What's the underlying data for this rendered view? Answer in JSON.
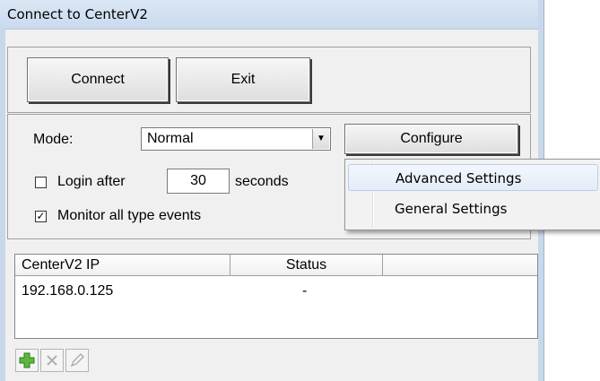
{
  "window": {
    "title": "Connect to CenterV2"
  },
  "buttons": {
    "connect": "Connect",
    "exit": "Exit",
    "configure": "Configure"
  },
  "mode": {
    "label": "Mode:",
    "value": "Normal"
  },
  "login": {
    "label": "Login after",
    "value": "30",
    "unit": "seconds",
    "checked": false
  },
  "monitor": {
    "label": "Monitor all type events",
    "checked": true
  },
  "configure_menu": {
    "items": [
      "Advanced Settings",
      "General Settings"
    ]
  },
  "table": {
    "columns": [
      "CenterV2 IP",
      "Status"
    ],
    "rows": [
      {
        "ip": "192.168.0.125",
        "status": "-"
      }
    ]
  },
  "toolbar": {
    "icons": [
      "add-icon",
      "delete-icon",
      "edit-icon"
    ]
  }
}
